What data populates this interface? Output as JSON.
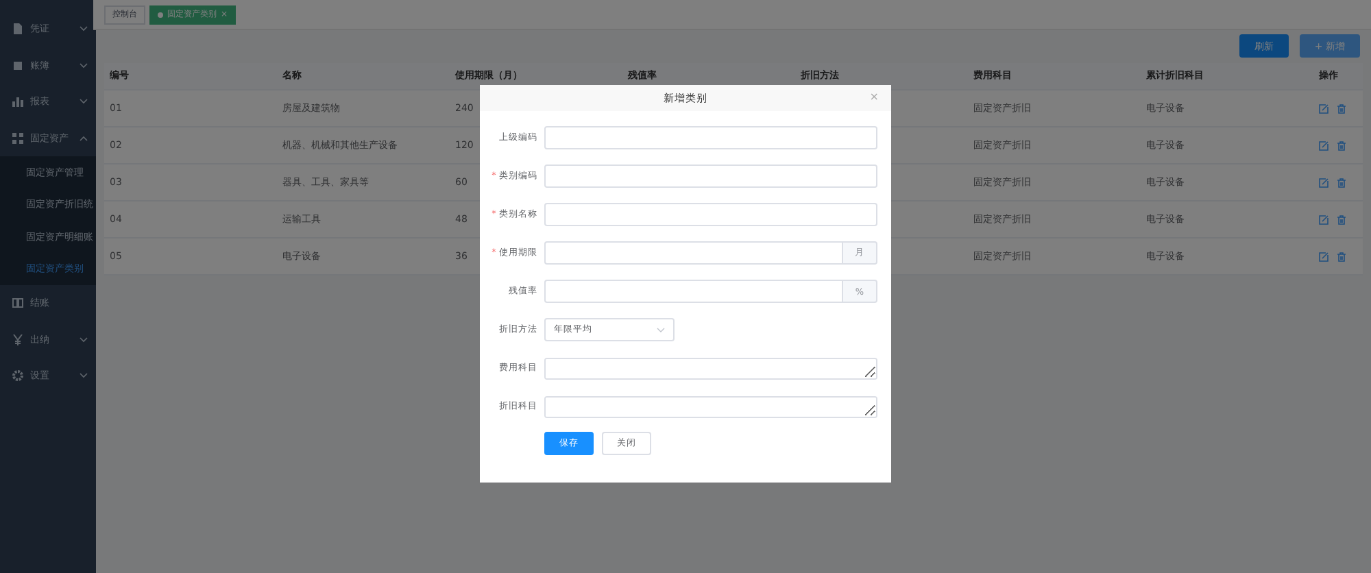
{
  "sidebar": {
    "items": [
      {
        "label": "凭证",
        "expanded": false
      },
      {
        "label": "账簿",
        "expanded": false
      },
      {
        "label": "报表",
        "expanded": false
      },
      {
        "label": "固定资产",
        "expanded": true,
        "children": [
          {
            "label": "固定资产管理",
            "selected": false
          },
          {
            "label": "固定资产折旧统",
            "selected": false
          },
          {
            "label": "固定资产明细账",
            "selected": false
          },
          {
            "label": "固定资产类别",
            "selected": true
          }
        ]
      },
      {
        "label": "结账"
      },
      {
        "label": "出纳",
        "expanded": false
      },
      {
        "label": "设置",
        "expanded": false
      }
    ]
  },
  "tags": [
    {
      "label": "控制台",
      "selected": false
    },
    {
      "label": "固定资产类别",
      "selected": true,
      "close": "×"
    }
  ],
  "toolbar": {
    "buttons": [
      {
        "label": "刷新",
        "kind": "primary"
      },
      {
        "label": "+ 新增",
        "kind": "light"
      }
    ]
  },
  "table": {
    "columns": [
      "编号",
      "名称",
      "使用期限（月）",
      "残值率",
      "折旧方法",
      "费用科目",
      "累计折旧科目",
      "操作"
    ],
    "rows": [
      {
        "cells": [
          "01",
          "房屋及建筑物",
          "240",
          "固定资产折旧",
          "电子设备"
        ]
      },
      {
        "cells": [
          "02",
          "机器、机械和其他生产设备",
          "120",
          "固定资产折旧",
          "电子设备"
        ]
      },
      {
        "cells": [
          "03",
          "器具、工具、家具等",
          "60",
          "固定资产折旧",
          "电子设备"
        ]
      },
      {
        "cells": [
          "04",
          "运输工具",
          "48",
          "固定资产折旧",
          "电子设备"
        ]
      },
      {
        "cells": [
          "05",
          "电子设备",
          "36",
          "固定资产折旧",
          "电子设备"
        ]
      }
    ]
  },
  "dialog": {
    "title": "新增类别",
    "close": "×",
    "fields": [
      {
        "label": "上级编码",
        "kind": "text"
      },
      {
        "label": "类别编码",
        "kind": "text",
        "marker": "*"
      },
      {
        "label": "类别名称",
        "kind": "text",
        "marker": "*"
      },
      {
        "label": "使用期限",
        "kind": "suffix",
        "marker": "*",
        "suffix": "月"
      },
      {
        "label": "残值率",
        "kind": "suffix",
        "suffix": "%"
      },
      {
        "label": "折旧方法",
        "kind": "select",
        "value": "年限平均"
      },
      {
        "label": "费用科目",
        "kind": "textarea"
      },
      {
        "label": "折旧科目",
        "kind": "textarea"
      }
    ],
    "buttons": [
      {
        "label": "保存",
        "kind": "primary"
      },
      {
        "label": "关闭",
        "kind": "plain"
      }
    ]
  }
}
